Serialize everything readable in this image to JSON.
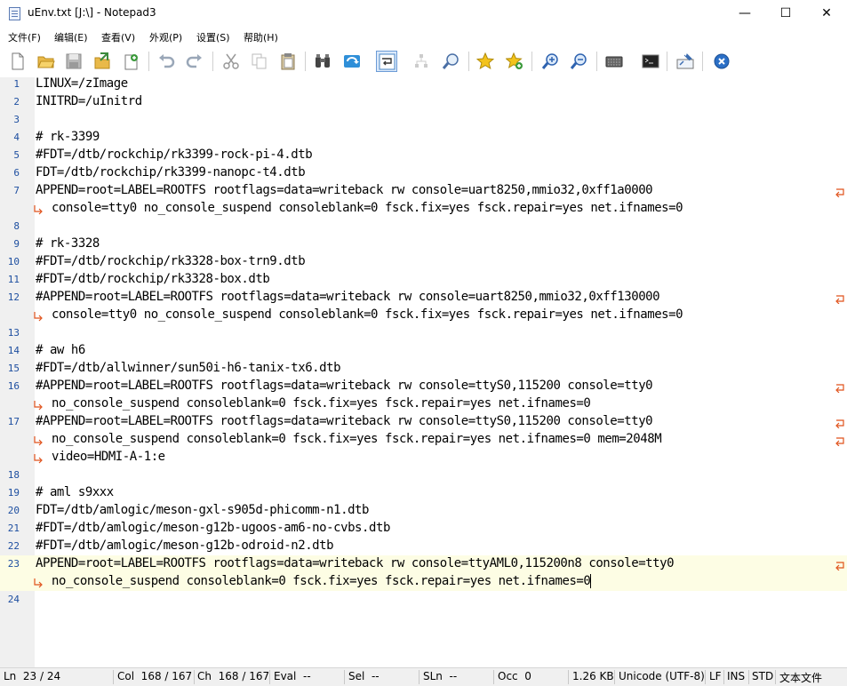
{
  "window": {
    "title": "uEnv.txt [J:\\] - Notepad3",
    "minimize_glyph": "—",
    "maximize_glyph": "☐",
    "close_glyph": "✕"
  },
  "menu": [
    "文件(F)",
    "编辑(E)",
    "查看(V)",
    "外观(P)",
    "设置(S)",
    "帮助(H)"
  ],
  "toolbar": [
    {
      "icon": "new-file-icon"
    },
    {
      "icon": "open-folder-icon"
    },
    {
      "icon": "save-icon"
    },
    {
      "icon": "save-as-icon"
    },
    {
      "icon": "save-copy-icon"
    },
    {
      "icon": "undo-icon"
    },
    {
      "icon": "redo-icon"
    },
    {
      "icon": "cut-icon"
    },
    {
      "icon": "copy-icon"
    },
    {
      "icon": "paste-icon"
    },
    {
      "icon": "find-icon"
    },
    {
      "icon": "replace-icon"
    },
    {
      "icon": "word-wrap-icon",
      "active": true
    },
    {
      "icon": "select-matches-icon"
    },
    {
      "icon": "zoom-find-icon"
    },
    {
      "icon": "star-icon"
    },
    {
      "icon": "star-add-icon"
    },
    {
      "icon": "zoom-in-icon"
    },
    {
      "icon": "zoom-out-icon"
    },
    {
      "icon": "keyboard-icon"
    },
    {
      "icon": "console-icon"
    },
    {
      "icon": "pin-icon"
    },
    {
      "icon": "exit-icon"
    }
  ],
  "editor": {
    "rows": [
      {
        "ln": "1",
        "text": "LINUX=/zImage"
      },
      {
        "ln": "2",
        "text": "INITRD=/uInitrd"
      },
      {
        "ln": "3",
        "text": ""
      },
      {
        "ln": "4",
        "text": "# rk-3399"
      },
      {
        "ln": "5",
        "text": "#FDT=/dtb/rockchip/rk3399-rock-pi-4.dtb"
      },
      {
        "ln": "6",
        "text": "FDT=/dtb/rockchip/rk3399-nanopc-t4.dtb"
      },
      {
        "ln": "7",
        "text": "APPEND=root=LABEL=ROOTFS rootflags=data=writeback rw console=uart8250,mmio32,0xff1a0000",
        "wrap_end": true
      },
      {
        "ln": "",
        "text": "console=tty0 no_console_suspend consoleblank=0 fsck.fix=yes fsck.repair=yes net.ifnames=0",
        "wrap_start": true
      },
      {
        "ln": "8",
        "text": ""
      },
      {
        "ln": "9",
        "text": "# rk-3328"
      },
      {
        "ln": "10",
        "text": "#FDT=/dtb/rockchip/rk3328-box-trn9.dtb"
      },
      {
        "ln": "11",
        "text": "#FDT=/dtb/rockchip/rk3328-box.dtb"
      },
      {
        "ln": "12",
        "text": "#APPEND=root=LABEL=ROOTFS rootflags=data=writeback rw console=uart8250,mmio32,0xff130000",
        "wrap_end": true
      },
      {
        "ln": "",
        "text": "console=tty0 no_console_suspend consoleblank=0 fsck.fix=yes fsck.repair=yes net.ifnames=0",
        "wrap_start": true
      },
      {
        "ln": "13",
        "text": ""
      },
      {
        "ln": "14",
        "text": "# aw h6"
      },
      {
        "ln": "15",
        "text": "#FDT=/dtb/allwinner/sun50i-h6-tanix-tx6.dtb"
      },
      {
        "ln": "16",
        "text": "#APPEND=root=LABEL=ROOTFS rootflags=data=writeback rw console=ttyS0,115200 console=tty0",
        "wrap_end": true
      },
      {
        "ln": "",
        "text": "no_console_suspend consoleblank=0 fsck.fix=yes fsck.repair=yes net.ifnames=0",
        "wrap_start": true
      },
      {
        "ln": "17",
        "text": "#APPEND=root=LABEL=ROOTFS rootflags=data=writeback rw console=ttyS0,115200 console=tty0",
        "wrap_end": true
      },
      {
        "ln": "",
        "text": "no_console_suspend consoleblank=0 fsck.fix=yes fsck.repair=yes net.ifnames=0 mem=2048M",
        "wrap_start": true,
        "wrap_end": true
      },
      {
        "ln": "",
        "text": "video=HDMI-A-1:e",
        "wrap_start": true
      },
      {
        "ln": "18",
        "text": ""
      },
      {
        "ln": "19",
        "text": "# aml s9xxx"
      },
      {
        "ln": "20",
        "text": "FDT=/dtb/amlogic/meson-gxl-s905d-phicomm-n1.dtb"
      },
      {
        "ln": "21",
        "text": "#FDT=/dtb/amlogic/meson-g12b-ugoos-am6-no-cvbs.dtb"
      },
      {
        "ln": "22",
        "text": "#FDT=/dtb/amlogic/meson-g12b-odroid-n2.dtb"
      },
      {
        "ln": "23",
        "text": "APPEND=root=LABEL=ROOTFS rootflags=data=writeback rw console=ttyAML0,115200n8 console=tty0",
        "wrap_end": true,
        "current": true
      },
      {
        "ln": "",
        "text": "no_console_suspend consoleblank=0 fsck.fix=yes fsck.repair=yes net.ifnames=0",
        "wrap_start": true,
        "current": true,
        "caret": true
      },
      {
        "ln": "24",
        "text": ""
      }
    ]
  },
  "statusbar": {
    "ln": "Ln  23 / 24",
    "col": "Col  168 / 167",
    "ch": "Ch  168 / 167",
    "eval": "Eval  --",
    "sel": "Sel  --",
    "sln": "SLn  --",
    "occ": "Occ  0",
    "size": "1.26 KB",
    "encoding": "Unicode (UTF-8)",
    "eol": "LF",
    "ins": "INS",
    "std": "STD",
    "filetype": "文本文件"
  },
  "colors": {
    "line_number": "#1e4fa0",
    "current_line_bg": "#fdfde4",
    "wrap_marker": "#e0521b"
  }
}
